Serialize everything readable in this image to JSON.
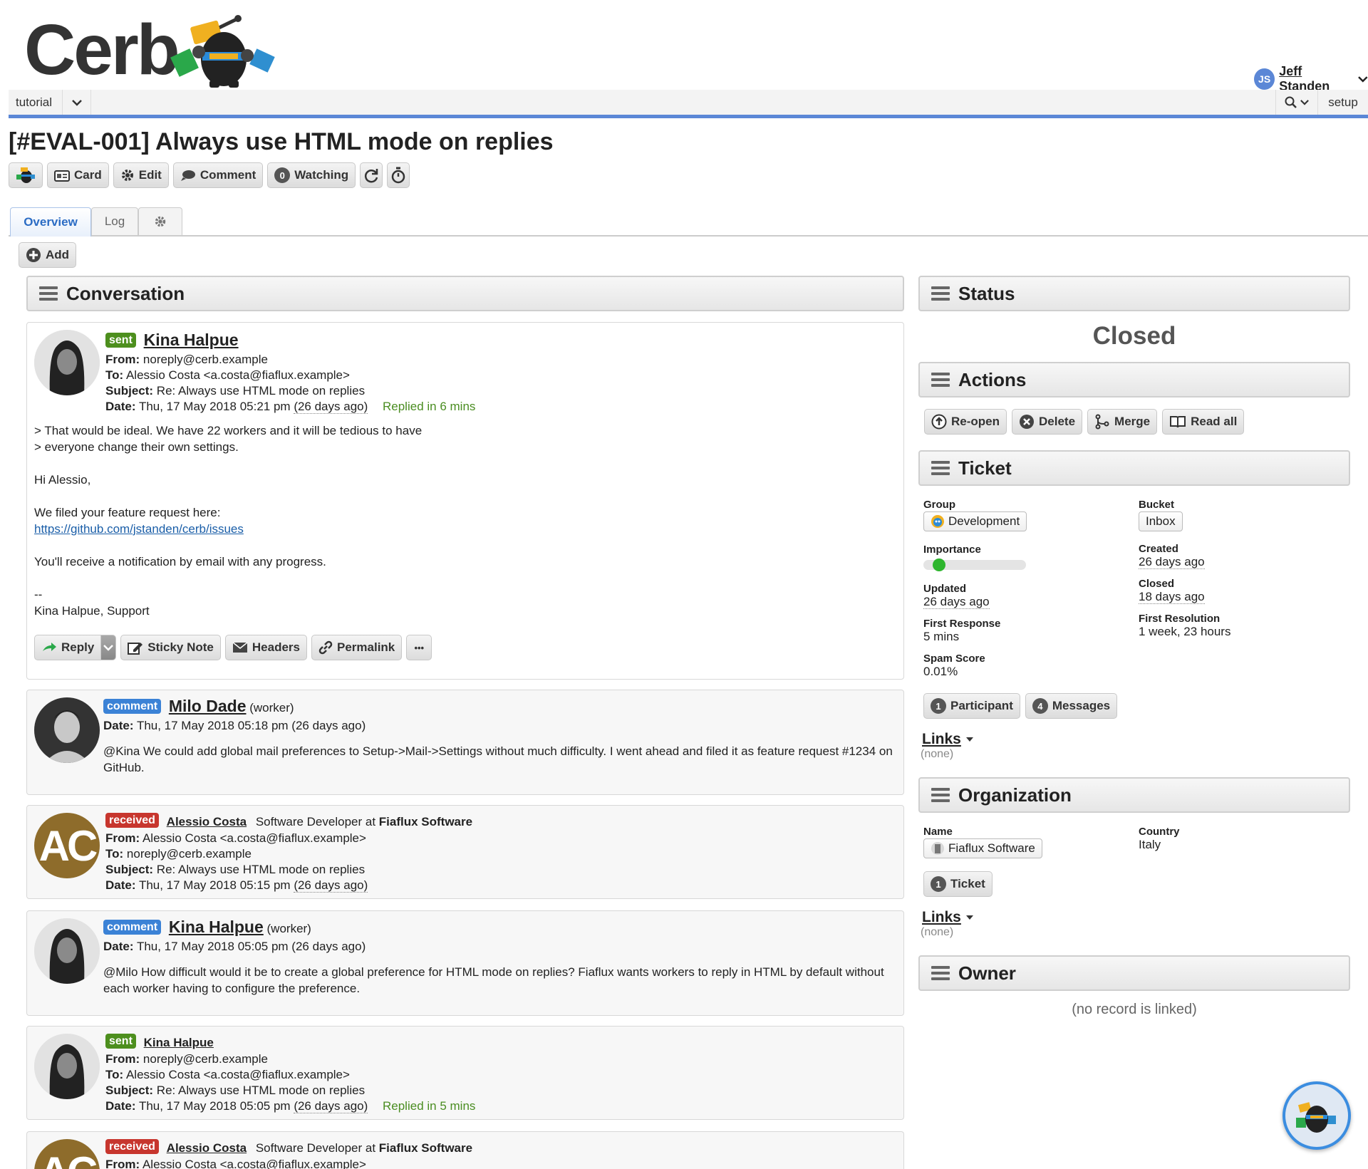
{
  "logo": {
    "text": "Cerb"
  },
  "header": {
    "menu_tab": "tutorial",
    "user_initials": "JS",
    "user_name": "Jeff Standen",
    "setup": "setup"
  },
  "page": {
    "title": "[#EVAL-001] Always use HTML mode on replies",
    "toolbar": {
      "card": "Card",
      "edit": "Edit",
      "comment": "Comment",
      "watchers_count": "0",
      "watching": "Watching"
    },
    "tabs": [
      "Overview",
      "Log"
    ],
    "add_label": "Add"
  },
  "conversation": {
    "title": "Conversation",
    "messages": [
      {
        "badge": "sent",
        "name": "Kina Halpue",
        "from": "noreply@cerb.example",
        "to": "Alessio Costa <a.costa@fiaflux.example>",
        "subject": "Re: Always use HTML mode on replies",
        "date_label": "Date:",
        "date": "Thu, 17 May 2018 05:21 pm",
        "date_ago": "(26 days ago)",
        "replied": "Replied in 6 mins",
        "body": [
          "> That would be ideal. We have 22 workers and it will be tedious to have",
          "> everyone change their own settings.",
          "",
          "Hi Alessio,",
          "",
          "We filed your feature request here:"
        ],
        "link": "https://github.com/jstanden/cerb/issues",
        "body2": [
          "",
          "You'll receive a notification by email with any progress.",
          "",
          "--",
          "Kina Halpue, Support"
        ],
        "actions": {
          "reply": "Reply",
          "sticky": "Sticky Note",
          "headers": "Headers",
          "permalink": "Permalink",
          "more": "•••"
        }
      },
      {
        "badge": "comment",
        "name": "Milo Dade",
        "role": "(worker)",
        "date": "Thu, 17 May 2018 05:18 pm (26 days ago)",
        "body": "@Kina We could add global mail preferences to Setup->Mail->Settings without much difficulty. I went ahead and filed it as feature request #1234 on GitHub."
      },
      {
        "badge": "received",
        "name": "Alessio Costa",
        "title_text": "Software Developer at",
        "org": "Fiaflux Software",
        "avatar_text": "AC",
        "from": "Alessio Costa <a.costa@fiaflux.example>",
        "to": "noreply@cerb.example",
        "subject": "Re: Always use HTML mode on replies",
        "date": "Thu, 17 May 2018 05:15 pm",
        "date_ago": "(26 days ago)"
      },
      {
        "badge": "comment",
        "name": "Kina Halpue",
        "role": "(worker)",
        "date": "Thu, 17 May 2018 05:05 pm (26 days ago)",
        "body": "@Milo How difficult would it be to create a global preference for HTML mode on replies? Fiaflux wants workers to reply in HTML by default without each worker having to configure the preference."
      },
      {
        "badge": "sent",
        "name": "Kina Halpue",
        "from": "noreply@cerb.example",
        "to": "Alessio Costa <a.costa@fiaflux.example>",
        "subject": "Re: Always use HTML mode on replies",
        "date": "Thu, 17 May 2018 05:05 pm",
        "date_ago": "(26 days ago)",
        "replied": "Replied in 5 mins"
      },
      {
        "badge": "received",
        "name": "Alessio Costa",
        "title_text": "Software Developer at",
        "org": "Fiaflux Software",
        "avatar_text": "AC",
        "from": "Alessio Costa <a.costa@fiaflux.example>"
      }
    ],
    "labels": {
      "from": "From:",
      "to": "To:",
      "subject": "Subject:",
      "date": "Date:"
    }
  },
  "status": {
    "title": "Status",
    "value": "Closed"
  },
  "actions": {
    "title": "Actions",
    "reopen": "Re-open",
    "delete": "Delete",
    "merge": "Merge",
    "read_all": "Read all"
  },
  "ticket": {
    "title": "Ticket",
    "group_label": "Group",
    "group": "Development",
    "bucket_label": "Bucket",
    "bucket": "Inbox",
    "importance_label": "Importance",
    "importance": 0.1,
    "created_label": "Created",
    "created": "26 days ago",
    "updated_label": "Updated",
    "updated": "26 days ago",
    "closed_label": "Closed",
    "closed": "18 days ago",
    "first_response_label": "First Response",
    "first_response": "5 mins",
    "first_resolution_label": "First Resolution",
    "first_resolution": "1 week, 23 hours",
    "spam_label": "Spam Score",
    "spam": "0.01%",
    "participants_count": "1",
    "participants": "Participant",
    "messages_count": "4",
    "messages": "Messages",
    "links": "Links",
    "links_none": "(none)"
  },
  "organization": {
    "title": "Organization",
    "name_label": "Name",
    "name": "Fiaflux Software",
    "country_label": "Country",
    "country": "Italy",
    "ticket_count": "1",
    "ticket": "Ticket",
    "links": "Links",
    "links_none": "(none)"
  },
  "owner": {
    "title": "Owner",
    "none": "(no record is linked)"
  },
  "colors": {
    "accent": "#5b87d6",
    "sent": "#4d8f1e",
    "received": "#c7362e",
    "comment": "#3b82d6",
    "importance": "#2db52d"
  }
}
